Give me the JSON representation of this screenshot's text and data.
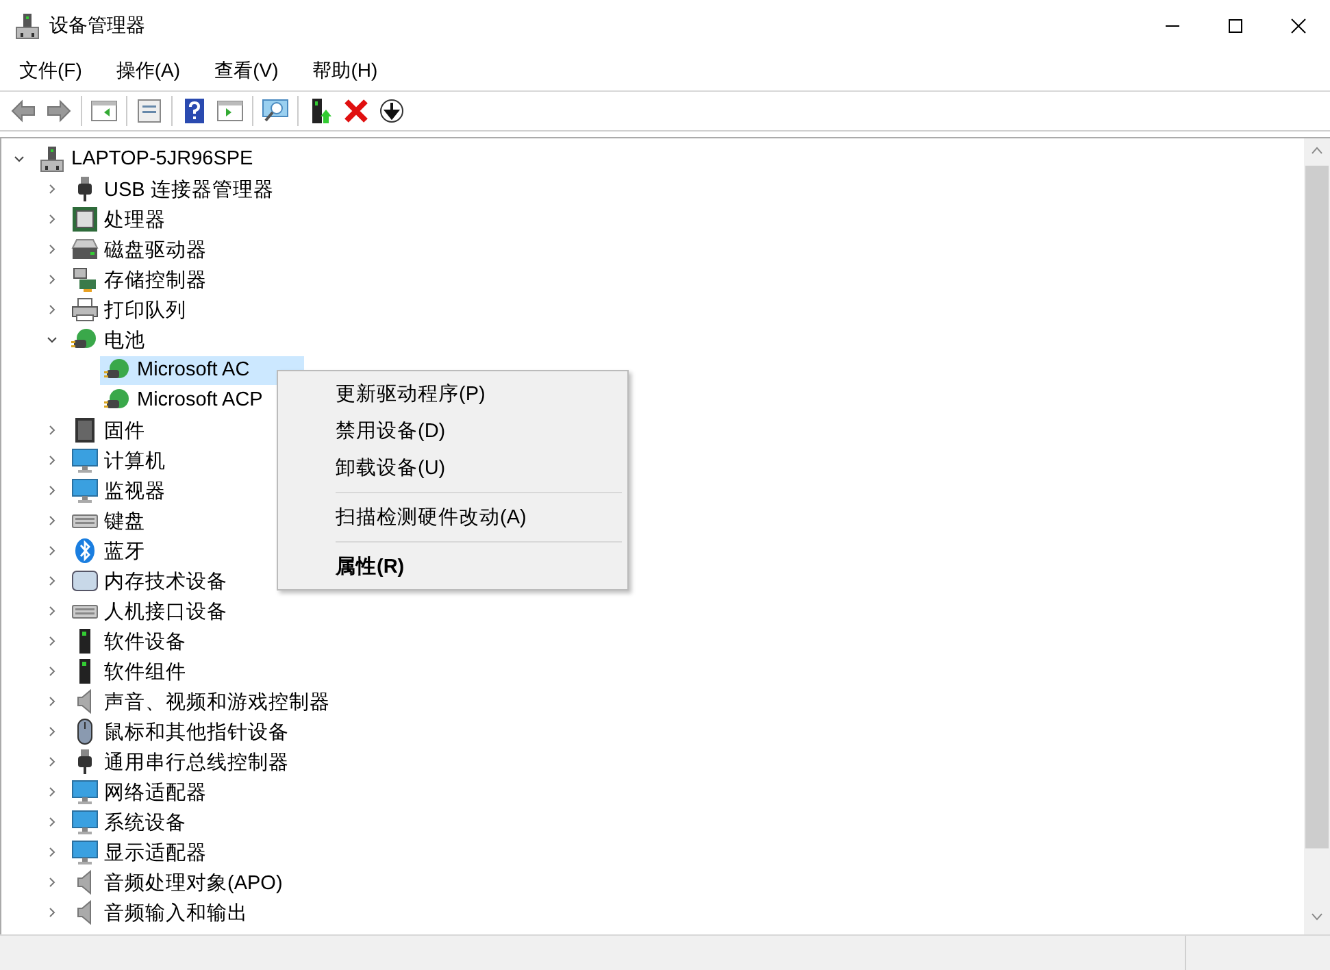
{
  "window": {
    "title": "设备管理器"
  },
  "menu": [
    "文件(F)",
    "操作(A)",
    "查看(V)",
    "帮助(H)"
  ],
  "tree": {
    "label": "LAPTOP-5JR96SPE",
    "expanded": true,
    "selected": false,
    "children": [
      {
        "label": "USB 连接器管理器",
        "expanded": false,
        "selected": false
      },
      {
        "label": "处理器",
        "expanded": false,
        "selected": false
      },
      {
        "label": "磁盘驱动器",
        "expanded": false,
        "selected": false
      },
      {
        "label": "存储控制器",
        "expanded": false,
        "selected": false
      },
      {
        "label": "打印队列",
        "expanded": false,
        "selected": false
      },
      {
        "label": "电池",
        "expanded": true,
        "selected": false,
        "children": [
          {
            "label": "Microsoft AC",
            "selected": true
          },
          {
            "label": "Microsoft ACP",
            "selected": false
          }
        ]
      },
      {
        "label": "固件",
        "expanded": false,
        "selected": false
      },
      {
        "label": "计算机",
        "expanded": false,
        "selected": false
      },
      {
        "label": "监视器",
        "expanded": false,
        "selected": false
      },
      {
        "label": "键盘",
        "expanded": false,
        "selected": false
      },
      {
        "label": "蓝牙",
        "expanded": false,
        "selected": false
      },
      {
        "label": "内存技术设备",
        "expanded": false,
        "selected": false
      },
      {
        "label": "人机接口设备",
        "expanded": false,
        "selected": false
      },
      {
        "label": "软件设备",
        "expanded": false,
        "selected": false
      },
      {
        "label": "软件组件",
        "expanded": false,
        "selected": false
      },
      {
        "label": "声音、视频和游戏控制器",
        "expanded": false,
        "selected": false
      },
      {
        "label": "鼠标和其他指针设备",
        "expanded": false,
        "selected": false
      },
      {
        "label": "通用串行总线控制器",
        "expanded": false,
        "selected": false
      },
      {
        "label": "网络适配器",
        "expanded": false,
        "selected": false
      },
      {
        "label": "系统设备",
        "expanded": false,
        "selected": false
      },
      {
        "label": "显示适配器",
        "expanded": false,
        "selected": false
      },
      {
        "label": "音频处理对象(APO)",
        "expanded": false,
        "selected": false
      },
      {
        "label": "音频输入和输出",
        "expanded": false,
        "selected": false
      }
    ]
  },
  "context_menu": {
    "items": [
      {
        "kind": "item",
        "label": "更新驱动程序(P)",
        "default": false
      },
      {
        "kind": "item",
        "label": "禁用设备(D)",
        "default": false
      },
      {
        "kind": "item",
        "label": "卸载设备(U)",
        "default": false
      },
      {
        "kind": "separator"
      },
      {
        "kind": "item",
        "label": "扫描检测硬件改动(A)",
        "default": false
      },
      {
        "kind": "separator"
      },
      {
        "kind": "item",
        "label": "属性(R)",
        "default": true
      }
    ]
  }
}
